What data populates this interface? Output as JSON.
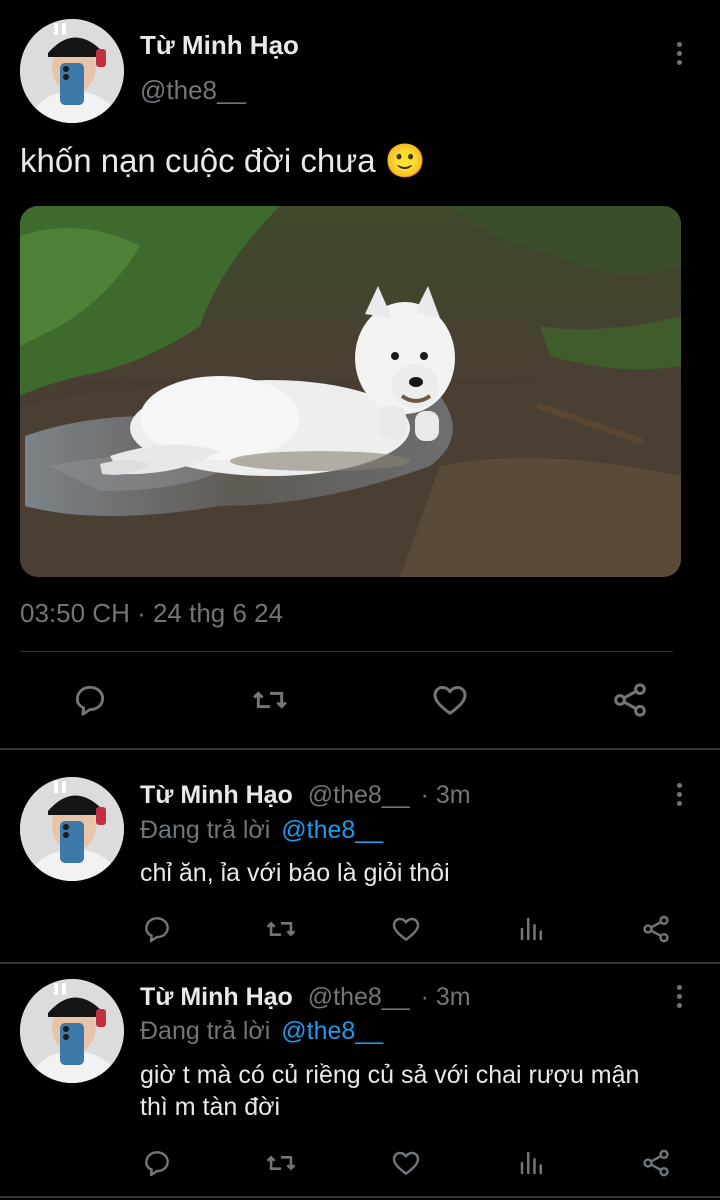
{
  "main_tweet": {
    "author_name": "Từ Minh Hạo",
    "handle": "@the8__",
    "text": "khốn nạn cuộc đời chưa 🙂",
    "timestamp": "03:50 CH · 24 thg 6 24",
    "image_desc_icon": "photo-white-dog-in-mud",
    "actions": [
      "reply-icon",
      "retweet-icon",
      "like-icon",
      "share-icon"
    ]
  },
  "replies": [
    {
      "author_name": "Từ Minh Hạo",
      "handle": "@the8__",
      "time": "· 3m",
      "replying_prefix": "Đang trả lời",
      "replying_to": "@the8__",
      "text": "chỉ ăn, ỉa với báo là giỏi thôi"
    },
    {
      "author_name": "Từ Minh Hạo",
      "handle": "@the8__",
      "time": "· 3m",
      "replying_prefix": "Đang trả lời",
      "replying_to": "@the8__",
      "text_line1": "giờ t mà có củ riềng củ sả với chai rượu mận",
      "text_line2": "thì m tàn đời"
    }
  ],
  "colors": {
    "background": "#000000",
    "text": "#e7e9ea",
    "muted": "#71767b",
    "link": "#1d9bf0",
    "divider": "#2f3336"
  }
}
